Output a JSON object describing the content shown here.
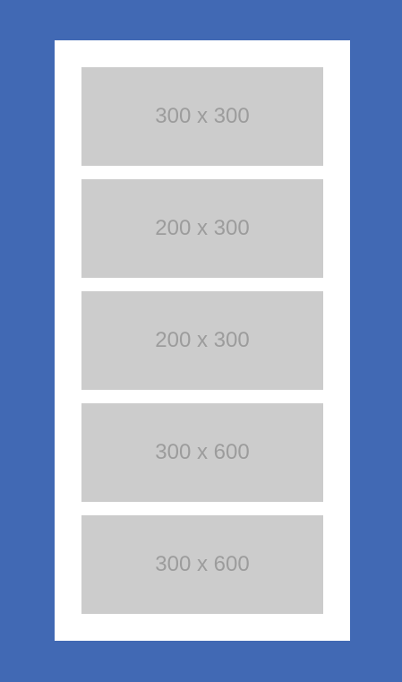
{
  "colors": {
    "page_background": "#4169b4",
    "card_background": "#ffffff",
    "placeholder_background": "#cccccc",
    "placeholder_text": "#9c9c9c"
  },
  "placeholders": [
    {
      "label": "300 x 300"
    },
    {
      "label": "200 x 300"
    },
    {
      "label": "200 x 300"
    },
    {
      "label": "300 x 600"
    },
    {
      "label": "300 x 600"
    }
  ]
}
